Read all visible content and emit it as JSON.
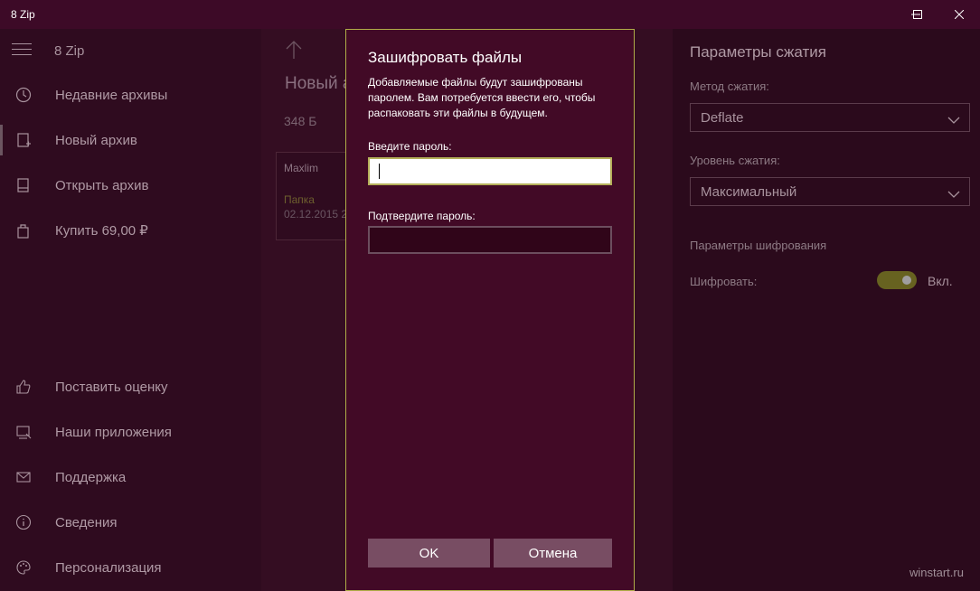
{
  "window": {
    "title": "8 Zip"
  },
  "sidebar": {
    "app_name": "8 Zip",
    "items": [
      {
        "label": "Недавние архивы",
        "icon": "clock-icon"
      },
      {
        "label": "Новый архив",
        "icon": "new-archive-icon"
      },
      {
        "label": "Открыть архив",
        "icon": "open-archive-icon"
      },
      {
        "label": "Купить 69,00 ₽",
        "icon": "shopping-bag-icon"
      }
    ],
    "bottom_items": [
      {
        "label": "Поставить оценку",
        "icon": "thumbs-up-icon"
      },
      {
        "label": "Наши приложения",
        "icon": "store-icon"
      },
      {
        "label": "Поддержка",
        "icon": "mail-icon"
      },
      {
        "label": "Сведения",
        "icon": "info-icon"
      },
      {
        "label": "Персонализация",
        "icon": "palette-icon"
      }
    ]
  },
  "middle": {
    "archive_title": "Новый архив",
    "archive_size": "348 Б",
    "file": {
      "name": "Maxlim",
      "type": "Папка",
      "date": "02.12.2015 21:00"
    }
  },
  "settings": {
    "heading": "Параметры сжатия",
    "method_label": "Метод сжатия:",
    "method_value": "Deflate",
    "level_label": "Уровень сжатия:",
    "level_value": "Максимальный",
    "encryption_heading": "Параметры шифрования",
    "encrypt_label": "Шифровать:",
    "encrypt_state": "Вкл."
  },
  "dialog": {
    "title": "Зашифровать файлы",
    "description": "Добавляемые файлы будут зашифрованы паролем. Вам потребуется ввести его, чтобы распаковать эти файлы в будущем.",
    "password_label": "Введите пароль:",
    "password_value": "",
    "confirm_label": "Подтвердите пароль:",
    "confirm_value": "",
    "ok_label": "OK",
    "cancel_label": "Отмена"
  },
  "watermark": "winstart.ru",
  "colors": {
    "accent_border": "#b0ad48",
    "dialog_bg": "#420a26",
    "toggle_on": "#676220"
  }
}
